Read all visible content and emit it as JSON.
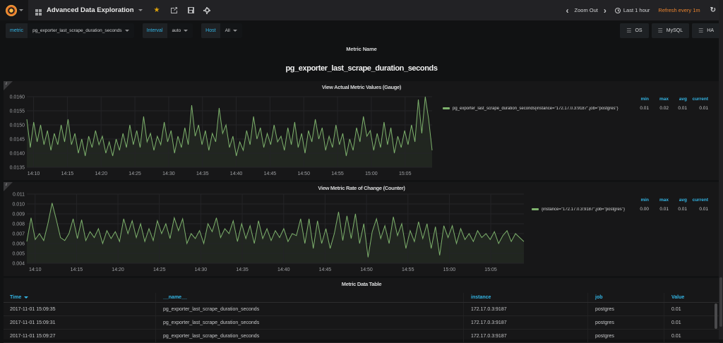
{
  "navbar": {
    "dashboard_title": "Advanced Data Exploration",
    "zoom_out": "Zoom Out",
    "time_range": "Last 1 hour",
    "refresh_text": "Refresh every 1m"
  },
  "submenu": {
    "variables": [
      {
        "label": "metric",
        "value": "pg_exporter_last_scrape_duration_seconds"
      },
      {
        "label": "Interval",
        "value": "auto"
      },
      {
        "label": "Host",
        "value": "All"
      }
    ],
    "links": [
      {
        "label": "OS"
      },
      {
        "label": "MySQL"
      },
      {
        "label": "HA"
      }
    ]
  },
  "metric_header": {
    "panel_title": "Metric Name",
    "metric_name": "pg_exporter_last_scrape_duration_seconds"
  },
  "colors": {
    "accent_blue": "#33b5e5",
    "series_green": "#7eb26d",
    "refresh_orange": "#e9832e",
    "star_yellow": "#e0a40a"
  },
  "chart_data": [
    {
      "type": "line",
      "title": "View Actual Metric Values (Gauge)",
      "legend": {
        "label": "pg_exporter_last_scrape_duration_seconds{instance=\"172.17.0.3:9187\",job=\"postgres\"}",
        "stat_headers": {
          "min": "min",
          "max": "max",
          "avg": "avg",
          "current": "current"
        },
        "min": "0.01",
        "max": "0.02",
        "avg": "0.01",
        "current": "0.01"
      },
      "x_ticks": [
        "14:10",
        "14:15",
        "14:20",
        "14:25",
        "14:30",
        "14:35",
        "14:40",
        "14:45",
        "14:50",
        "14:55",
        "15:00",
        "15:05"
      ],
      "x_range_minutes": 60,
      "first_tick_offset_min": 1,
      "tick_interval_min": 5,
      "y_ticks": [
        "0.0160",
        "0.0155",
        "0.0150",
        "0.0145",
        "0.0140",
        "0.0135"
      ],
      "ylim": [
        0.0135,
        0.016
      ],
      "value_scale": 0.0001,
      "values": [
        152,
        142,
        151,
        144,
        150,
        143,
        148,
        141,
        147,
        143,
        150,
        144,
        152,
        143,
        147,
        140,
        145,
        139,
        146,
        142,
        148,
        143,
        146,
        140,
        144,
        139,
        145,
        141,
        147,
        142,
        150,
        143,
        148,
        142,
        153,
        144,
        147,
        141,
        146,
        143,
        151,
        144,
        148,
        140,
        146,
        142,
        149,
        143,
        157,
        146,
        150,
        143,
        148,
        141,
        147,
        144,
        156,
        147,
        150,
        142,
        146,
        139,
        144,
        141,
        148,
        143,
        153,
        145,
        149,
        142,
        147,
        143,
        150,
        144,
        146,
        141,
        149,
        143,
        151,
        142,
        147,
        140,
        148,
        144,
        152,
        145,
        149,
        141,
        146,
        142,
        150,
        143,
        147,
        139,
        145,
        141,
        149,
        144,
        153,
        146,
        148,
        141,
        147,
        142,
        151,
        143,
        149,
        140,
        146,
        142,
        148,
        143,
        150,
        144,
        159,
        147,
        160,
        152,
        141
      ]
    },
    {
      "type": "line",
      "title": "View Metric Rate of Change (Counter)",
      "legend": {
        "label": "{instance=\"172.17.0.3:9187\",job=\"postgres\"}",
        "stat_headers": {
          "min": "min",
          "max": "max",
          "avg": "avg",
          "current": "current"
        },
        "min": "0.00",
        "max": "0.01",
        "avg": "0.01",
        "current": "0.01"
      },
      "x_ticks": [
        "14:10",
        "14:15",
        "14:20",
        "14:25",
        "14:30",
        "14:35",
        "14:40",
        "14:45",
        "14:50",
        "14:55",
        "15:00",
        "15:05"
      ],
      "x_range_minutes": 60,
      "first_tick_offset_min": 1,
      "tick_interval_min": 5,
      "y_ticks": [
        "0.011",
        "0.010",
        "0.009",
        "0.008",
        "0.007",
        "0.006",
        "0.005",
        "0.004"
      ],
      "ylim": [
        0.004,
        0.011
      ],
      "value_scale": 0.0001,
      "values": [
        62,
        86,
        64,
        70,
        63,
        80,
        101,
        84,
        66,
        63,
        70,
        85,
        65,
        84,
        63,
        72,
        66,
        75,
        60,
        73,
        65,
        72,
        62,
        85,
        70,
        83,
        66,
        80,
        62,
        75,
        63,
        83,
        70,
        80,
        65,
        86,
        73,
        85,
        60,
        70,
        65,
        73,
        60,
        80,
        72,
        86,
        66,
        75,
        70,
        83,
        62,
        80,
        65,
        78,
        60,
        83,
        65,
        75,
        63,
        73,
        66,
        75,
        62,
        70,
        68,
        85,
        60,
        85,
        55,
        83,
        60,
        75,
        55,
        70,
        92,
        63,
        88,
        65,
        90,
        60,
        80,
        46,
        72,
        85,
        65,
        78,
        60,
        87,
        68,
        80,
        55,
        73,
        62,
        82,
        65,
        80,
        55,
        77,
        48,
        78,
        66,
        78,
        60,
        75,
        64,
        70,
        62,
        73,
        66,
        70,
        64,
        72,
        60,
        68,
        73,
        62,
        70,
        66,
        62
      ]
    }
  ],
  "table_panel": {
    "title": "Metric Data Table",
    "columns": [
      "Time",
      "__name__",
      "instance",
      "job",
      "Value"
    ],
    "sort_column": "Time",
    "rows": [
      [
        "2017-11-01 15:09:35",
        "pg_exporter_last_scrape_duration_seconds",
        "172.17.0.3:9187",
        "postgres",
        "0.01"
      ],
      [
        "2017-11-01 15:09:31",
        "pg_exporter_last_scrape_duration_seconds",
        "172.17.0.3:9187",
        "postgres",
        "0.01"
      ],
      [
        "2017-11-01 15:09:27",
        "pg_exporter_last_scrape_duration_seconds",
        "172.17.0.3:9187",
        "postgres",
        "0.01"
      ]
    ]
  }
}
